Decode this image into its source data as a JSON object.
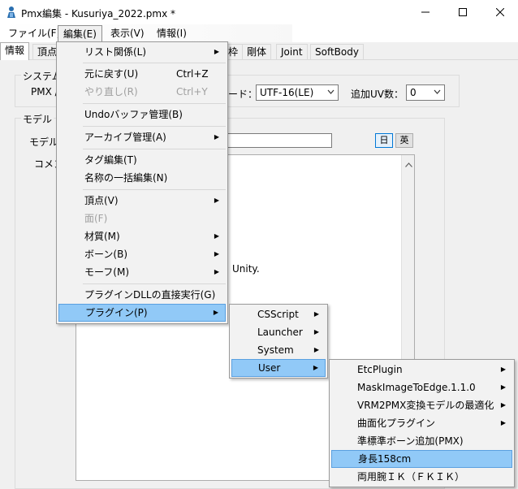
{
  "window": {
    "title": "Pmx編集 - Kusuriya_2022.pmx *",
    "min_glyph": "—",
    "max_glyph": "☐",
    "close_glyph": "✕"
  },
  "menubar": [
    "ファイル(F)",
    "編集(E)",
    "表示(V)",
    "情報(I)"
  ],
  "tabs": [
    "情報",
    "頂点",
    "枠",
    "剛体",
    "Joint",
    "SoftBody"
  ],
  "system_group": {
    "label": "システム",
    "pmx_label": "PMX /",
    "encoding_label": "ード：",
    "encoding_value": "UTF-16(LE)",
    "uv_label": "追加UV数：",
    "uv_value": "0"
  },
  "model_group": {
    "label": "モデル",
    "model_name_label": "モデル名",
    "comment_label": "コメン",
    "lang_ja": "日",
    "lang_en": "英",
    "comment_visible_text": "Unity."
  },
  "edit_menu": {
    "items": [
      {
        "label": "リスト関係(L)",
        "shortcut": "",
        "submenu": true,
        "disabled": false
      },
      {
        "label": "元に戻す(U)",
        "shortcut": "Ctrl+Z",
        "submenu": false,
        "disabled": false
      },
      {
        "label": "やり直し(R)",
        "shortcut": "Ctrl+Y",
        "submenu": false,
        "disabled": true
      },
      {
        "label": "Undoバッファ管理(B)",
        "shortcut": "",
        "submenu": false,
        "disabled": false
      },
      {
        "label": "アーカイブ管理(A)",
        "shortcut": "",
        "submenu": true,
        "disabled": false
      },
      {
        "label": "タグ編集(T)",
        "shortcut": "",
        "submenu": false,
        "disabled": false
      },
      {
        "label": "名称の一括編集(N)",
        "shortcut": "",
        "submenu": false,
        "disabled": false
      },
      {
        "label": "頂点(V)",
        "shortcut": "",
        "submenu": true,
        "disabled": false
      },
      {
        "label": "面(F)",
        "shortcut": "",
        "submenu": false,
        "disabled": true
      },
      {
        "label": "材質(M)",
        "shortcut": "",
        "submenu": true,
        "disabled": false
      },
      {
        "label": "ボーン(B)",
        "shortcut": "",
        "submenu": true,
        "disabled": false
      },
      {
        "label": "モーフ(M)",
        "shortcut": "",
        "submenu": true,
        "disabled": false
      },
      {
        "label": "プラグインDLLの直接実行(G)",
        "shortcut": "",
        "submenu": false,
        "disabled": false
      },
      {
        "label": "プラグイン(P)",
        "shortcut": "",
        "submenu": true,
        "disabled": false
      }
    ]
  },
  "plugin_menu": {
    "items": [
      {
        "label": "CSScript",
        "submenu": true
      },
      {
        "label": "Launcher",
        "submenu": true
      },
      {
        "label": "System",
        "submenu": true
      },
      {
        "label": "User",
        "submenu": true
      }
    ]
  },
  "user_menu": {
    "items": [
      {
        "label": "EtcPlugin",
        "submenu": true
      },
      {
        "label": "MaskImageToEdge.1.1.0",
        "submenu": true
      },
      {
        "label": "VRM2PMX変換モデルの最適化",
        "submenu": true
      },
      {
        "label": "曲面化プラグイン",
        "submenu": true
      },
      {
        "label": "準標準ボーン追加(PMX)",
        "submenu": false
      },
      {
        "label": "身長158cm",
        "submenu": false
      },
      {
        "label": "両用腕ＩＫ（ＦＫＩＫ）",
        "submenu": false
      }
    ]
  },
  "submenu_arrow": "▶",
  "colors": {
    "highlight": "#91c9f7",
    "accent": "#0078d7"
  }
}
